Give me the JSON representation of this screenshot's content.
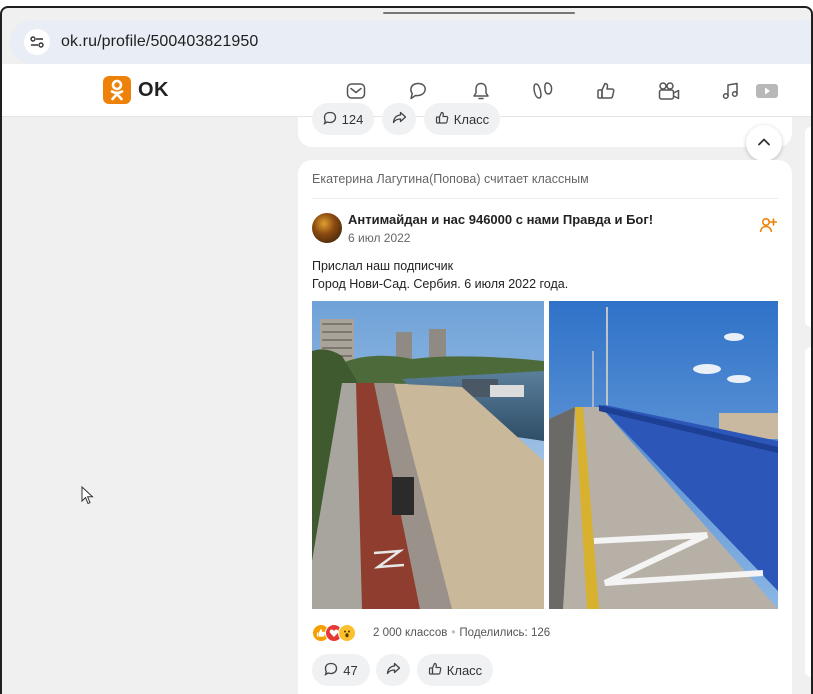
{
  "browser": {
    "url": "ok.ru/profile/500403821950",
    "site_info_icon": "tune-icon"
  },
  "header": {
    "logo_text": "OK",
    "brand_color": "#ee8208",
    "nav_icons": [
      "messages-icon",
      "discussions-icon",
      "notifications-icon",
      "guests-icon",
      "reactions-icon",
      "video-icon",
      "music-icon",
      "more-icon"
    ]
  },
  "previous_post": {
    "comments_count": "124",
    "share_icon": "share-icon",
    "like_label": "Класс"
  },
  "post": {
    "activity": "Екатерина Лагутина(Попова) считает классным",
    "author": "Антимайдан и нас 946000 с нами Правда и Бог!",
    "date": "6 июл 2022",
    "text_line1": "Прислал наш подписчик",
    "text_line2": "Город Нови-Сад. Сербия. 6 июля 2022 года.",
    "reactions": [
      "like-reaction-icon",
      "heart-reaction-icon",
      "wow-reaction-icon"
    ],
    "classes_count": "2 000 классов",
    "shared": "Поделились: 126",
    "comments_count": "47",
    "like_label": "Класс"
  }
}
